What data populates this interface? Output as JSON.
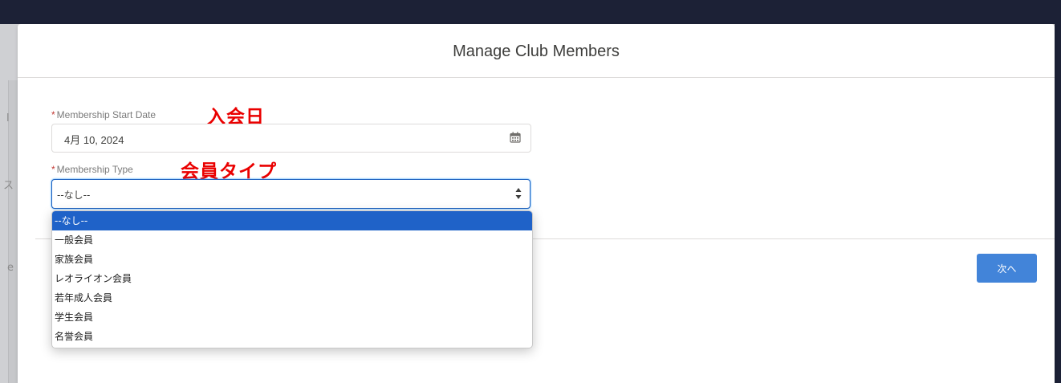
{
  "modal": {
    "title": "Manage Club Members"
  },
  "form": {
    "start_date": {
      "required_mark": "*",
      "label": "Membership Start Date",
      "annotation": "入会日",
      "value": "4月 10, 2024"
    },
    "membership_type": {
      "required_mark": "*",
      "label": "Membership Type",
      "annotation": "会員タイプ",
      "value": "--なし--",
      "options": [
        "--なし--",
        "一般会員",
        "家族会員",
        "レオライオン会員",
        "若年成人会員",
        "学生会員",
        "名誉会員"
      ],
      "selected_index": 0
    }
  },
  "footer": {
    "next_label": "次へ"
  },
  "background": {
    "frag_1": "l",
    "frag_2": "ス",
    "frag_3": "e"
  },
  "colors": {
    "annotation": "#ea0000",
    "selected_option": "#1f62c8",
    "next_button": "#4284d9",
    "required_mark": "#c23934"
  },
  "icons": {
    "calendar": "calendar-icon",
    "select_arrows": "select-arrows-icon"
  }
}
